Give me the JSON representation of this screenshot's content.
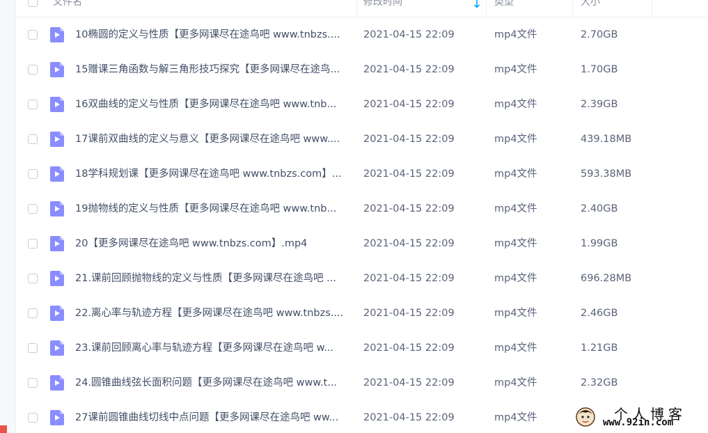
{
  "header": {
    "name": "文件名",
    "time": "修改时间",
    "type": "类型",
    "size": "大小"
  },
  "colors": {
    "icon": "#8a8dff",
    "text": "#424e67",
    "header_text": "#878c9c",
    "sort_arrow": "#06a7ff"
  },
  "files": [
    {
      "name": "10椭圆的定义与性质【更多网课尽在途鸟吧 www.tnbzs....",
      "time": "2021-04-15 22:09",
      "type": "mp4文件",
      "size": "2.70GB"
    },
    {
      "name": "15赠课三角函数与解三角形技巧探究【更多网课尽在途鸟...",
      "time": "2021-04-15 22:09",
      "type": "mp4文件",
      "size": "1.70GB"
    },
    {
      "name": "16双曲线的定义与性质【更多网课尽在途鸟吧 www.tnb...",
      "time": "2021-04-15 22:09",
      "type": "mp4文件",
      "size": "2.39GB"
    },
    {
      "name": "17课前双曲线的定义与意义【更多网课尽在途鸟吧 www....",
      "time": "2021-04-15 22:09",
      "type": "mp4文件",
      "size": "439.18MB"
    },
    {
      "name": "18学科规划课【更多网课尽在途鸟吧 www.tnbzs.com】...",
      "time": "2021-04-15 22:09",
      "type": "mp4文件",
      "size": "593.38MB"
    },
    {
      "name": "19抛物线的定义与性质【更多网课尽在途鸟吧 www.tnb...",
      "time": "2021-04-15 22:09",
      "type": "mp4文件",
      "size": "2.40GB"
    },
    {
      "name": "20【更多网课尽在途鸟吧 www.tnbzs.com】.mp4",
      "time": "2021-04-15 22:09",
      "type": "mp4文件",
      "size": "1.99GB"
    },
    {
      "name": "21.课前回顾抛物线的定义与性质【更多网课尽在途鸟吧 ...",
      "time": "2021-04-15 22:09",
      "type": "mp4文件",
      "size": "696.28MB"
    },
    {
      "name": "22.离心率与轨迹方程【更多网课尽在途鸟吧 www.tnbzs....",
      "time": "2021-04-15 22:09",
      "type": "mp4文件",
      "size": "2.46GB"
    },
    {
      "name": "23.课前回顾离心率与轨迹方程【更多网课尽在途鸟吧 w...",
      "time": "2021-04-15 22:09",
      "type": "mp4文件",
      "size": "1.21GB"
    },
    {
      "name": "24.圆锥曲线弦长面积问题【更多网课尽在途鸟吧 www.t...",
      "time": "2021-04-15 22:09",
      "type": "mp4文件",
      "size": "2.32GB"
    },
    {
      "name": "27课前圆锥曲线切线中点问题【更多网课尽在途鸟吧 ww...",
      "time": "2021-04-15 22:09",
      "type": "mp4文件",
      "size": ""
    }
  ],
  "watermark": {
    "title": "个人博客",
    "url": "www.92in.com"
  }
}
